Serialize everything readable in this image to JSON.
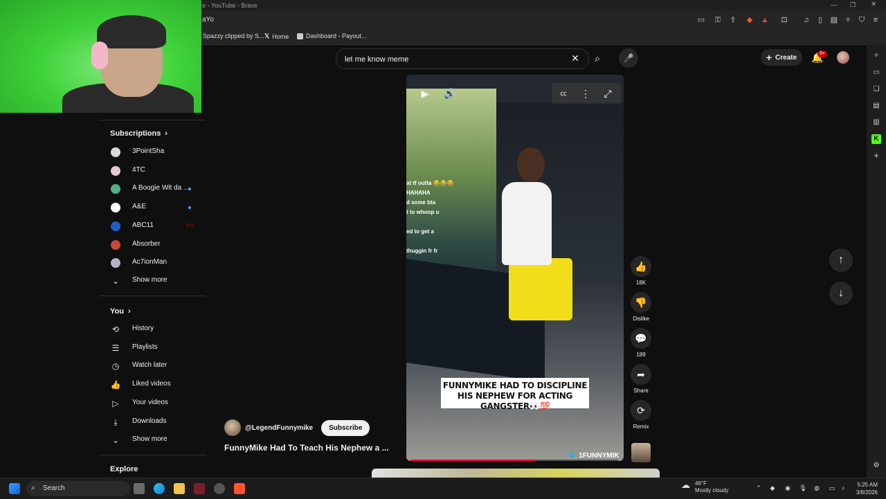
{
  "browser": {
    "window_title": "e - YouTube - Brave",
    "tab_title": "aYo",
    "bookmarks": [
      "Spazzy clipped by S...",
      "Home",
      "Dashboard - Payout..."
    ],
    "colors": {
      "accent": "#ff0033",
      "brave": "#fb542b"
    }
  },
  "search": {
    "query": "let me know meme",
    "clear_icon": "✕",
    "search_icon": "⌕",
    "mic_icon": "🎤"
  },
  "header": {
    "create_label": "Create",
    "notification_count": "9+"
  },
  "sidebar": {
    "subscriptions_label": "Subscriptions",
    "channels": [
      {
        "name": "3PointSha",
        "color": "#d9d9d9",
        "indicator": "none"
      },
      {
        "name": "4TC",
        "color": "#e8c7d0",
        "indicator": "none"
      },
      {
        "name": "A Boogie Wit da ...",
        "color": "#4fb08a",
        "indicator": "dot"
      },
      {
        "name": "A&E",
        "color": "#ffffff",
        "indicator": "dot"
      },
      {
        "name": "ABC11",
        "color": "#1f5ec9",
        "indicator": "live"
      },
      {
        "name": "Absorber",
        "color": "#c9473a",
        "indicator": "none"
      },
      {
        "name": "Ac7ionMan",
        "color": "#b0b6c4",
        "indicator": "none"
      }
    ],
    "show_more_1": "Show more",
    "you_label": "You",
    "you_items": [
      {
        "label": "History",
        "icon": "history-icon"
      },
      {
        "label": "Playlists",
        "icon": "playlists-icon"
      },
      {
        "label": "Watch later",
        "icon": "watch-later-icon"
      },
      {
        "label": "Liked videos",
        "icon": "liked-icon"
      },
      {
        "label": "Your videos",
        "icon": "your-videos-icon"
      },
      {
        "label": "Downloads",
        "icon": "downloads-icon"
      }
    ],
    "show_more_2": "Show more",
    "explore_label": "Explore"
  },
  "video": {
    "overlay_lines": [
      "at tf outta 😂😂😂",
      "HAHAHA",
      "d some bta",
      "t to whoop u",
      "",
      "ed to get a",
      "",
      "thuggin fr fr"
    ],
    "caption": "FUNNYMIKE HAD TO DISCIPLINE HIS NEPHEW FOR ACTING GANGSTER👀💯",
    "watermark": "🐦 1FUNNYMIK",
    "progress": 0.6
  },
  "actions": [
    {
      "label": "18K",
      "icon": "like-icon",
      "glyph": "👍"
    },
    {
      "label": "Dislike",
      "icon": "dislike-icon",
      "glyph": "👎"
    },
    {
      "label": "189",
      "icon": "comments-icon",
      "glyph": "💬"
    },
    {
      "label": "Share",
      "icon": "share-icon",
      "glyph": "➦"
    },
    {
      "label": "Remix",
      "icon": "remix-icon",
      "glyph": "⟳"
    }
  ],
  "channel": {
    "handle": "@LegendFunnymike",
    "subscribe_label": "Subscribe"
  },
  "video_title": "FunnyMike Had To Teach His Nephew a ...",
  "taskbar": {
    "search_label": "Search",
    "weather_temp": "46°F",
    "weather_desc": "Mostly cloudy",
    "time": "5:25 AM",
    "date": "3/8/2026"
  }
}
